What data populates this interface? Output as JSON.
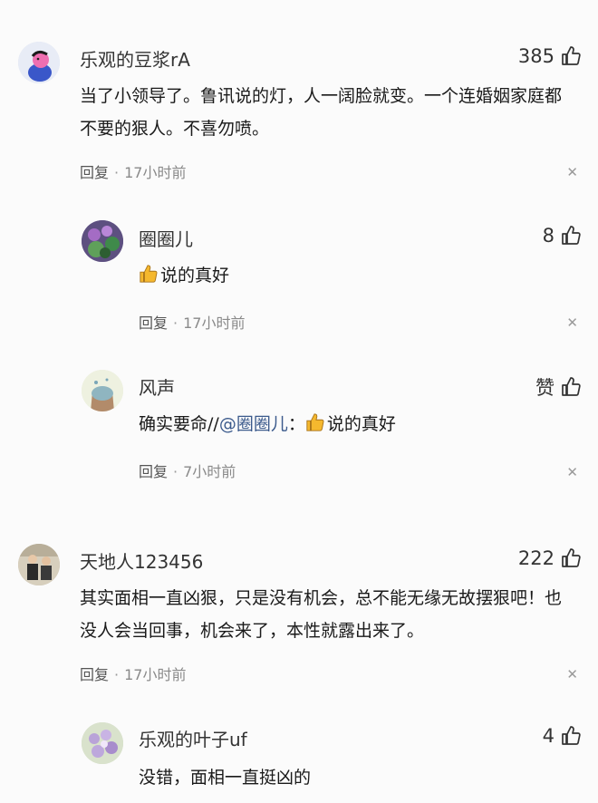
{
  "comments": [
    {
      "id": "c1",
      "username": "乐观的豆浆rA",
      "likes": "385",
      "text": "当了小领导了。鲁讯说的灯，人一阔脸就变。一个连婚姻家庭都不要的狠人。不喜勿喷。",
      "reply_label": "回复",
      "time": "17小时前"
    },
    {
      "id": "c1r1",
      "username": "圈圈儿",
      "likes": "8",
      "text": "说的真好",
      "reply_label": "回复",
      "time": "17小时前"
    },
    {
      "id": "c1r2",
      "username": "风声",
      "likes": "赞",
      "text_prefix": "确实要命//",
      "mention": "@圈圈儿",
      "text_suffix": "：",
      "quoted": "说的真好",
      "reply_label": "回复",
      "time": "7小时前"
    },
    {
      "id": "c2",
      "username": "天地人123456",
      "likes": "222",
      "text": "其实面相一直凶狠，只是没有机会，总不能无缘无故摆狠吧！也没人会当回事，机会来了，本性就露出来了。",
      "reply_label": "回复",
      "time": "17小时前"
    },
    {
      "id": "c2r1",
      "username": "乐观的叶子uf",
      "likes": "4",
      "text": "没错，面相一直挺凶的"
    }
  ],
  "meta_separator": "·",
  "close_glyph": "✕",
  "colors": {
    "background": "#fbfbfb",
    "mention": "#3b5a8c",
    "thumb_emoji": "#f5b82e"
  }
}
